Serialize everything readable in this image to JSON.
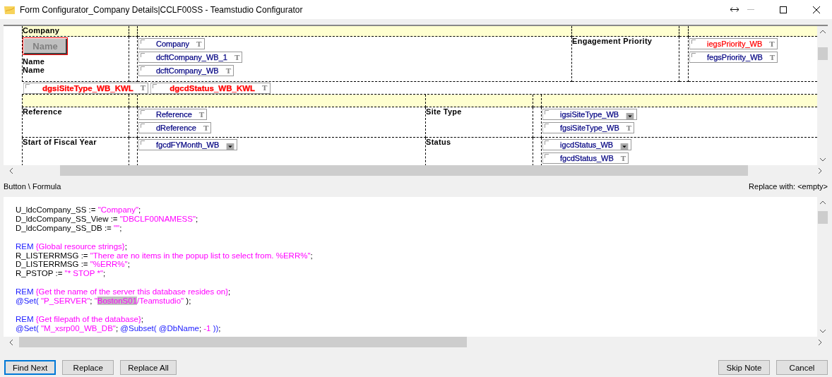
{
  "window": {
    "title": "Form Configurator_Company Details|CCLF00SS - Teamstudio Configurator"
  },
  "design": {
    "table_1": {
      "header": "Company",
      "name_button": {
        "text": "Name",
        "selected": true
      },
      "labels": [
        "Name",
        "Name"
      ],
      "fields": [
        {
          "text": "Company",
          "kind": "text",
          "icon": "T",
          "color": "#000080"
        },
        {
          "text": "dcftCompany_WB_1",
          "kind": "text",
          "icon": "T",
          "color": "#000080"
        },
        {
          "text": "dcftCompany_WB",
          "kind": "text",
          "icon": "T",
          "color": "#000080"
        }
      ],
      "label_2": "Engagement Priority",
      "fields_2": [
        {
          "text": "iegsPriority_WB",
          "kind": "text",
          "icon": "T",
          "color": "#ff0000"
        },
        {
          "text": "fegsPriority_WB",
          "kind": "text",
          "icon": "T",
          "color": "#000080"
        }
      ]
    },
    "hidden_fields": [
      {
        "text": "dgsiSiteType_WB_KWL",
        "kind": "text",
        "icon": "T",
        "color": "#ff0000"
      },
      {
        "text": "dgcdStatus_WB_KWL",
        "kind": "text",
        "icon": "T",
        "color": "#ff0000"
      }
    ],
    "table_2": {
      "rows": [
        {
          "label": "Reference",
          "fields": [
            {
              "text": "Reference",
              "kind": "text",
              "icon": "T",
              "color": "#000080"
            },
            {
              "text": "dReference",
              "kind": "text",
              "icon": "T",
              "color": "#000080"
            }
          ],
          "label_2": "Site Type",
          "fields_2": [
            {
              "text": "igsiSiteType_WB",
              "kind": "dropdown",
              "color": "#000080"
            },
            {
              "text": "fgsiSiteType_WB",
              "kind": "text",
              "icon": "T",
              "color": "#000080"
            }
          ]
        },
        {
          "label": "Start of Fiscal Year",
          "fields": [
            {
              "text": "fgcdFYMonth_WB",
              "kind": "dropdown",
              "color": "#000080"
            }
          ],
          "label_2": "Status",
          "fields_2": [
            {
              "text": "igcdStatus_WB",
              "kind": "dropdown",
              "color": "#000080"
            },
            {
              "text": "fgcdStatus_WB",
              "kind": "text",
              "icon": "T",
              "color": "#000080"
            }
          ]
        }
      ]
    }
  },
  "formula_label": "Button \\ Formula",
  "replace_label": "Replace with: <empty>",
  "code": [
    [
      [
        {
          "kind": "plain",
          "text": "U_ldcCompany_SS := "
        },
        {
          "kind": "string",
          "text": "\"Company\""
        },
        {
          "kind": "plain",
          "text": ";"
        }
      ],
      [
        {
          "kind": "plain",
          "text": "D_ldcCompany_SS_View := "
        },
        {
          "kind": "string",
          "text": "\"DBCLF00NAMESS\""
        },
        {
          "kind": "plain",
          "text": ";"
        }
      ],
      [
        {
          "kind": "plain",
          "text": "D_ldcCompany_SS_DB := "
        },
        {
          "kind": "string",
          "text": "\"\""
        },
        {
          "kind": "plain",
          "text": ";"
        }
      ]
    ],
    [
      [
        {
          "kind": "keyword",
          "text": "REM "
        },
        {
          "kind": "string",
          "text": "{Global resource strings}"
        },
        {
          "kind": "plain",
          "text": ";"
        }
      ],
      [
        {
          "kind": "plain",
          "text": "R_LISTERRMSG := "
        },
        {
          "kind": "string",
          "text": "\"There are no items in the popup list to select from. %ERR%\""
        },
        {
          "kind": "plain",
          "text": ";"
        }
      ],
      [
        {
          "kind": "plain",
          "text": "D_LISTERRMSG := "
        },
        {
          "kind": "string",
          "text": "\"%ERR%\""
        },
        {
          "kind": "plain",
          "text": ";"
        }
      ],
      [
        {
          "kind": "plain",
          "text": "R_PSTOP := "
        },
        {
          "kind": "string",
          "text": "\"* STOP *\""
        },
        {
          "kind": "plain",
          "text": ";"
        }
      ]
    ],
    [
      [
        {
          "kind": "keyword",
          "text": "REM "
        },
        {
          "kind": "string",
          "text": "{Get the name of the server this database resides on}"
        },
        {
          "kind": "plain",
          "text": ";"
        }
      ],
      [
        {
          "kind": "keyword",
          "text": "@Set( "
        },
        {
          "kind": "string",
          "text": "\"P_SERVER\""
        },
        {
          "kind": "plain",
          "text": "; "
        },
        {
          "kind": "string",
          "text": "\""
        },
        {
          "kind": "highlight",
          "text": "BostonS01"
        },
        {
          "kind": "string",
          "text": "/Teamstudio\""
        },
        {
          "kind": "plain",
          "text": " );"
        }
      ]
    ],
    [
      [
        {
          "kind": "keyword",
          "text": "REM "
        },
        {
          "kind": "string",
          "text": "{Get filepath of the database}"
        },
        {
          "kind": "plain",
          "text": ";"
        }
      ],
      [
        {
          "kind": "keyword",
          "text": "@Set( "
        },
        {
          "kind": "string",
          "text": "\"M_xsrp00_WB_DB\""
        },
        {
          "kind": "plain",
          "text": "; "
        },
        {
          "kind": "keyword",
          "text": "@Subset( @DbName"
        },
        {
          "kind": "plain",
          "text": "; "
        },
        {
          "kind": "string",
          "text": "-1"
        },
        {
          "kind": "keyword",
          "text": " ))"
        },
        {
          "kind": "plain",
          "text": ";"
        }
      ]
    ]
  ],
  "buttons_left": [
    {
      "label": "Find Next",
      "selected": true
    },
    {
      "label": "Replace",
      "selected": false
    },
    {
      "label": "Replace All",
      "selected": false
    }
  ],
  "buttons_right": [
    {
      "label": "Skip Note",
      "selected": false
    },
    {
      "label": "Cancel",
      "selected": false
    }
  ]
}
